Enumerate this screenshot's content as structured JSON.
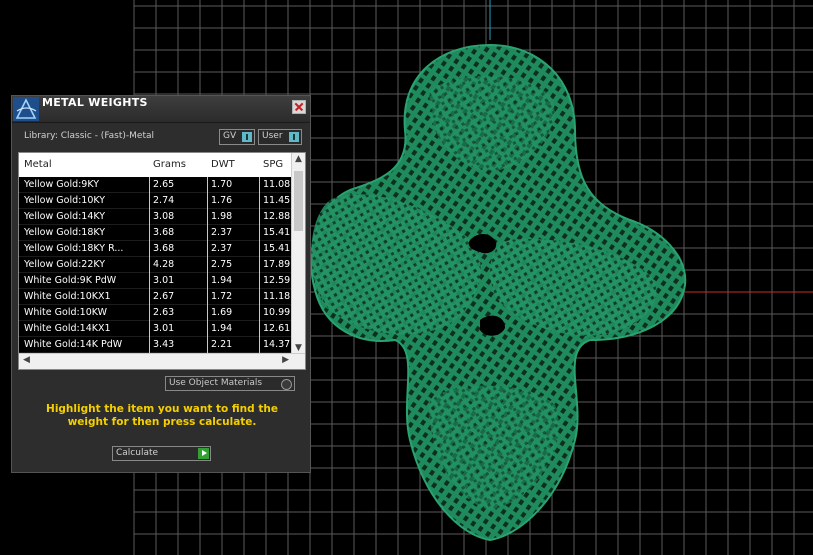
{
  "panel": {
    "title": "METAL WEIGHTS",
    "library_label": "Library: Classic - (Fast)-Metal",
    "gv_toggle": "GV",
    "user_toggle": "User",
    "use_object_materials": "Use Object Materials",
    "hint": "Highlight the item you want to find the weight for then press calculate.",
    "calculate_label": "Calculate"
  },
  "table": {
    "columns": [
      "Metal",
      "Grams",
      "DWT",
      "SPG"
    ],
    "rows": [
      [
        "Yellow Gold:9KY",
        "2.65",
        "1.70",
        "11.08"
      ],
      [
        "Yellow Gold:10KY",
        "2.74",
        "1.76",
        "11.45"
      ],
      [
        "Yellow Gold:14KY",
        "3.08",
        "1.98",
        "12.88"
      ],
      [
        "Yellow Gold:18KY",
        "3.68",
        "2.37",
        "15.41"
      ],
      [
        "Yellow Gold:18KY R...",
        "3.68",
        "2.37",
        "15.41"
      ],
      [
        "Yellow Gold:22KY",
        "4.28",
        "2.75",
        "17.89"
      ],
      [
        "White Gold:9K PdW",
        "3.01",
        "1.94",
        "12.59"
      ],
      [
        "White Gold:10KX1",
        "2.67",
        "1.72",
        "11.18"
      ],
      [
        "White Gold:10KW",
        "2.63",
        "1.69",
        "10.99"
      ],
      [
        "White Gold:14KX1",
        "3.01",
        "1.94",
        "12.61"
      ],
      [
        "White Gold:14K PdW",
        "3.43",
        "2.21",
        "14.37"
      ]
    ]
  },
  "colors": {
    "viewport_bg": "#000000",
    "grid": "#5a5a5a",
    "model": "#1f8a5c",
    "axis_x": "#c0302a",
    "axis_y": "#2aa0c0",
    "hint": "#f5d000"
  }
}
